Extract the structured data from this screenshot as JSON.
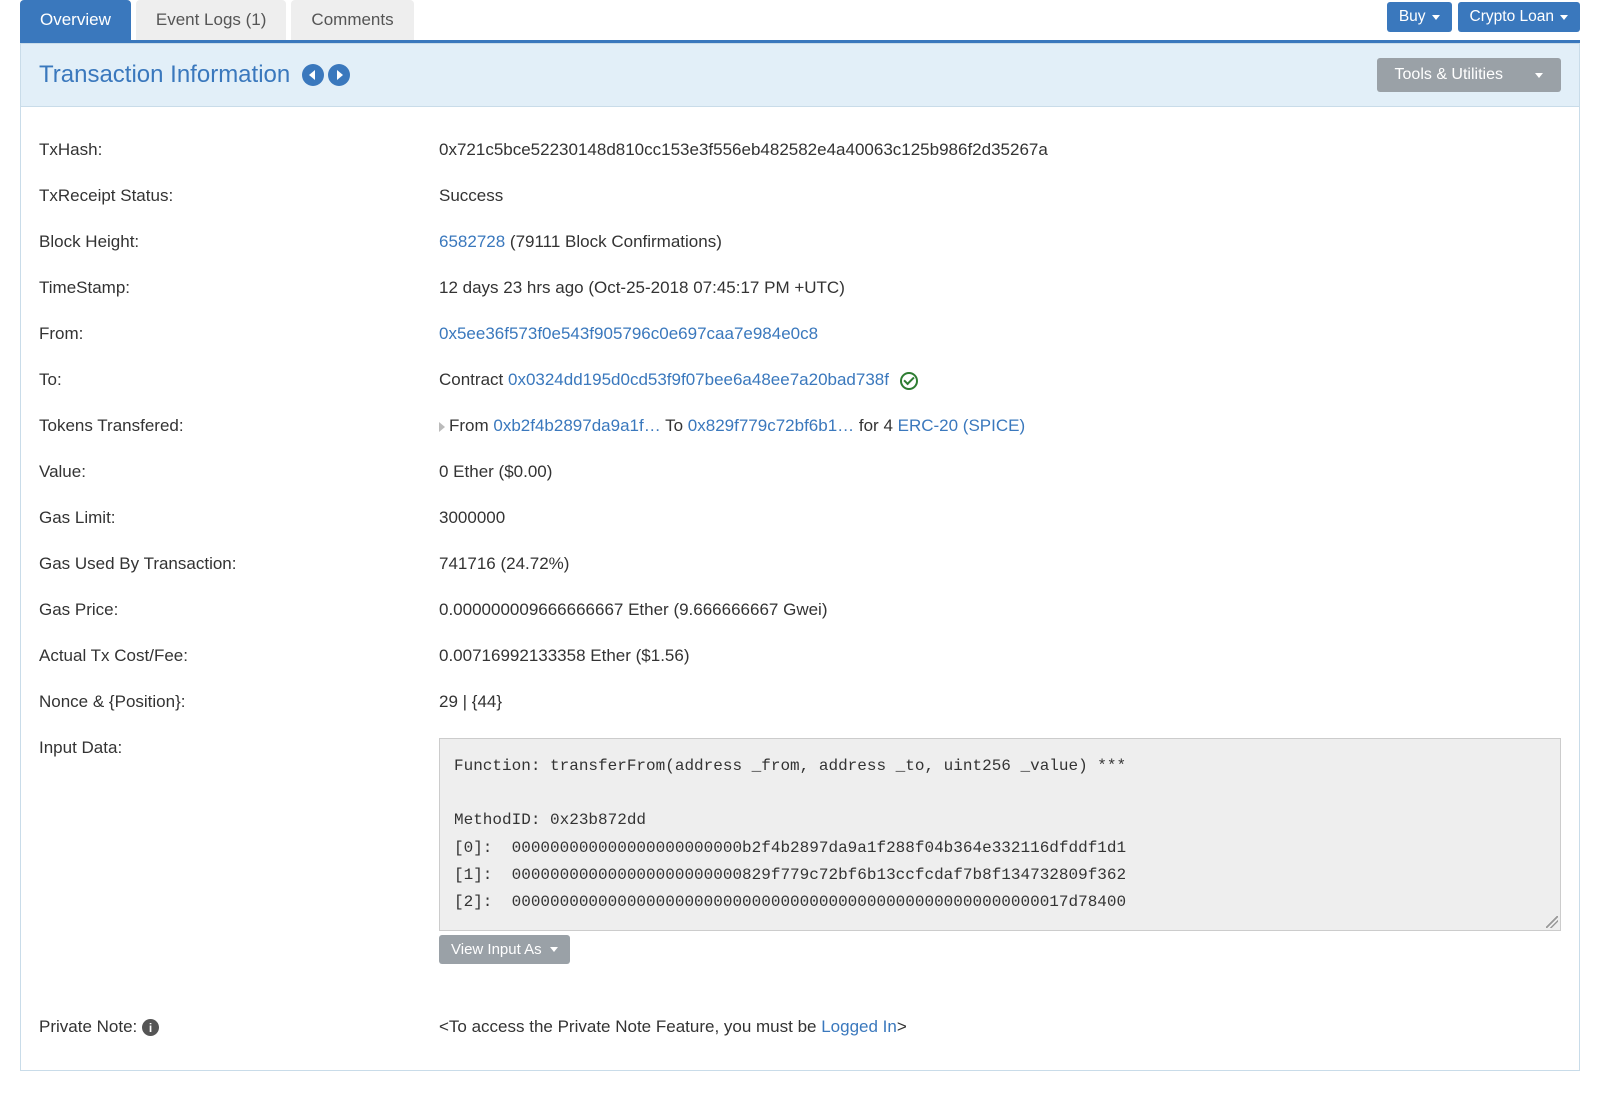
{
  "tabs": {
    "overview": "Overview",
    "event_logs": "Event Logs (1)",
    "comments": "Comments"
  },
  "top_buttons": {
    "buy": "Buy",
    "crypto_loan": "Crypto Loan"
  },
  "panel": {
    "title": "Transaction Information",
    "tools_btn": "Tools & Utilities"
  },
  "rows": {
    "txhash": {
      "label": "TxHash:",
      "value": "0x721c5bce52230148d810cc153e3f556eb482582e4a40063c125b986f2d35267a"
    },
    "status": {
      "label": "TxReceipt Status:",
      "value": "Success"
    },
    "block_height": {
      "label": "Block Height:",
      "link": "6582728",
      "confirmations": " (79111 Block Confirmations)"
    },
    "timestamp": {
      "label": "TimeStamp:",
      "value": "12 days 23 hrs ago (Oct-25-2018 07:45:17 PM +UTC)"
    },
    "from": {
      "label": "From:",
      "value": "0x5ee36f573f0e543f905796c0e697caa7e984e0c8"
    },
    "to": {
      "label": "To:",
      "prefix": "Contract ",
      "address": "0x0324dd195d0cd53f9f07bee6a48ee7a20bad738f"
    },
    "tokens": {
      "label": "Tokens Transfered:",
      "from_word": "From ",
      "from_addr": "0xb2f4b2897da9a1f…",
      "to_word": " To ",
      "to_addr": "0x829f779c72bf6b1…",
      "for_word": " for  4 ",
      "token_link": "ERC-20 (SPICE)"
    },
    "value": {
      "label": "Value:",
      "value": "0 Ether ($0.00)"
    },
    "gas_limit": {
      "label": "Gas Limit:",
      "value": "3000000"
    },
    "gas_used": {
      "label": "Gas Used By Transaction:",
      "value": "741716 (24.72%)"
    },
    "gas_price": {
      "label": "Gas Price:",
      "value": "0.000000009666666667 Ether (9.666666667 Gwei)"
    },
    "actual_cost": {
      "label": "Actual Tx Cost/Fee:",
      "value": "0.00716992133358 Ether ($1.56)"
    },
    "nonce": {
      "label": "Nonce & {Position}:",
      "value": "29 | {44}"
    },
    "input_data": {
      "label": "Input Data:",
      "content": "Function: transferFrom(address _from, address _to, uint256 _value) ***\n\nMethodID: 0x23b872dd\n[0]:  000000000000000000000000b2f4b2897da9a1f288f04b364e332116dfddf1d1\n[1]:  000000000000000000000000829f779c72bf6b13ccfcdaf7b8f134732809f362\n[2]:  0000000000000000000000000000000000000000000000000000000017d78400",
      "view_as_btn": "View Input As"
    },
    "private_note": {
      "label": "Private Note: ",
      "prefix": "<To access the Private Note Feature, you must be ",
      "link": "Logged In",
      "suffix": ">"
    }
  }
}
